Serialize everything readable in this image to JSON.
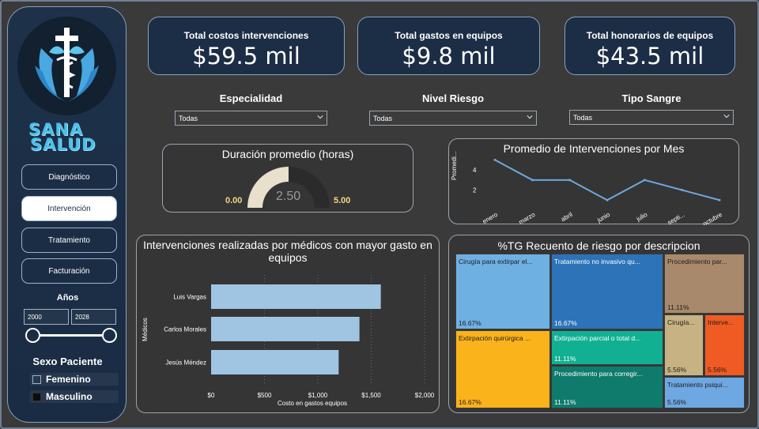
{
  "brand": {
    "line1": "SANA",
    "line2": "SALUD"
  },
  "nav": [
    {
      "label": "Diagnóstico",
      "active": false
    },
    {
      "label": "Intervención",
      "active": true
    },
    {
      "label": "Tratamiento",
      "active": false
    },
    {
      "label": "Facturación",
      "active": false
    }
  ],
  "years": {
    "title": "Años",
    "from": "2000",
    "to": "2028"
  },
  "sexo": {
    "title": "Sexo Paciente",
    "options": [
      "Femenino",
      "Masculino"
    ]
  },
  "kpis": [
    {
      "title": "Total costos intervenciones",
      "value": "$59.5 mil"
    },
    {
      "title": "Total gastos en equipos",
      "value": "$9.8 mil"
    },
    {
      "title": "Total honorarios de equipos",
      "value": "$43.5 mil"
    }
  ],
  "filters": [
    {
      "title": "Especialidad",
      "value": "Todas"
    },
    {
      "title": "Nivel Riesgo",
      "value": "Todas"
    },
    {
      "title": "Tipo Sangre",
      "value": "Todas"
    }
  ],
  "colors": {
    "navy": "#1c2d46",
    "bar": "#9fc5e3",
    "line": "#6fa8dc",
    "gauge_fill": "#e8e0cc",
    "gauge_bg": "#2b2b2b"
  },
  "gauge": {
    "title": "Duración promedio (horas)",
    "min": 0.0,
    "max": 5.0,
    "value": 2.5,
    "min_label": "0.00",
    "max_label": "5.00",
    "value_label": "2.50"
  },
  "chart_data": [
    {
      "type": "line",
      "title": "Promedio de Intervenciones por Mes",
      "ylabel": "Promedi...",
      "categories": [
        "enero",
        "marzo",
        "abril",
        "junio",
        "julio",
        "septi...",
        "octubre"
      ],
      "values": [
        5,
        3,
        3,
        1,
        3,
        2,
        1
      ],
      "yticks": [
        "4",
        "2"
      ],
      "ylim": [
        0,
        5.5
      ],
      "grid": false
    },
    {
      "type": "bar",
      "orientation": "horizontal",
      "title": "Intervenciones realizadas por médicos con mayor gasto en equipos",
      "xlabel": "Costo en gastos equipos",
      "ylabel": "Médicos",
      "categories": [
        "Luis Vargas",
        "Carlos Morales",
        "Jesús Méndez"
      ],
      "values": [
        1590,
        1390,
        1195
      ],
      "xticks": [
        "$0",
        "$500",
        "$1,000",
        "$1,500",
        "$2,000"
      ],
      "xlim": [
        0,
        2000
      ]
    },
    {
      "type": "treemap",
      "title": "%TG Recuento de riesgo por descripcion",
      "items": [
        {
          "label": "Cirugía para extirpar el...",
          "pct": "16.67%",
          "color": "#6fb0e3"
        },
        {
          "label": "Extirpación quirúrgica ...",
          "pct": "16.67%",
          "color": "#fbb31c"
        },
        {
          "label": "Tratamiento no invasivo qu...",
          "pct": "16.67%",
          "color": "#2c73b8"
        },
        {
          "label": "Extirpación parcial o total d...",
          "pct": "11.11%",
          "color": "#12b093"
        },
        {
          "label": "Procedimiento para corregir...",
          "pct": "11.11%",
          "color": "#0f7b6c"
        },
        {
          "label": "Procedimiento par...",
          "pct": "11.11%",
          "color": "#a9896b"
        },
        {
          "label": "Cirugía...",
          "pct": "5.56%",
          "color": "#c6b283"
        },
        {
          "label": "Interve...",
          "pct": "5.56%",
          "color": "#ef5b23"
        },
        {
          "label": "Tratamiento psiqui...",
          "pct": "5.56%",
          "color": "#6ea8e3"
        }
      ]
    }
  ]
}
